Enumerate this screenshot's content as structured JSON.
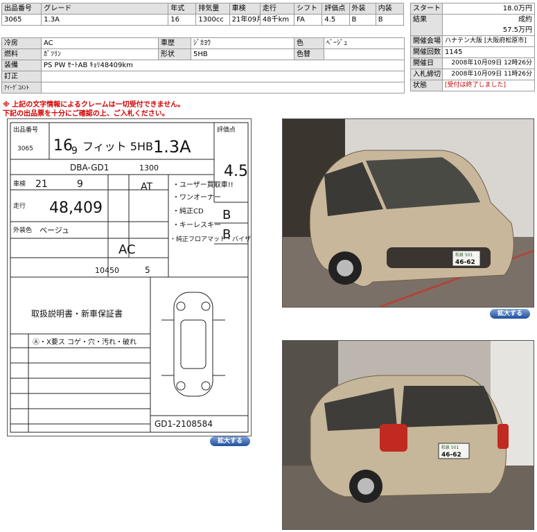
{
  "top_table": {
    "headers": [
      "出品番号",
      "グレード",
      "年式",
      "排気量",
      "車検",
      "走行",
      "シフト",
      "評価点",
      "外装",
      "内装"
    ],
    "values": [
      "3065",
      "1.3A",
      "16",
      "1300cc",
      "21年09月",
      "48千km",
      "FA",
      "4.5",
      "B",
      "B"
    ]
  },
  "spec_table": {
    "rows": [
      {
        "l1": "冷房",
        "v1": "AC",
        "l2": "車歴",
        "v2": "ｼﾞｶﾖｳ",
        "l3": "色",
        "v3": "ﾍﾞｰｼﾞｭ"
      },
      {
        "l1": "燃料",
        "v1": "ｶﾞｿﾘﾝ",
        "l2": "形状",
        "v2": "5HB",
        "l3": "色替",
        "v3": ""
      }
    ],
    "equipment_label": "装備",
    "equipment_value": "PS PW ｾｰﾄAB ｷｮﾘ48409km",
    "correction_label": "訂正",
    "correction_value": "",
    "eye_comment_label": "ｱｲｰｸﾞｺﾒﾝﾄ",
    "eye_comment_value": ""
  },
  "auction_table": {
    "start_label": "スタート",
    "start_value": "18.0万円",
    "result_label": "結果",
    "result_status": "成約",
    "result_price": "57.5万円",
    "venue_label": "開催会場",
    "venue_value": "ハナテン大阪 [大阪府松原市]",
    "count_label": "開催回数",
    "count_value": "1145",
    "date_label": "開催日",
    "date_value": "2008年10月09日 12時26分",
    "bid_end_label": "入札締切",
    "bid_end_value": "2008年10月09日 11時26分",
    "status_label": "状態",
    "status_value": "[受付は終了しました]"
  },
  "notice": {
    "line1": "※ 上記の文字情報によるクレームは一切受付できません。",
    "line2": "下記の出品票を十分にご確認の上、ご入札ください。"
  },
  "buttons": {
    "zoom_label": "拡大する"
  },
  "sheet": {
    "lot": "3065",
    "year": "16",
    "month": "9",
    "model": "フィット 5HB",
    "grade": "1.3A",
    "score": "4.5",
    "type_code": "DBA-GD1",
    "cc": "1300",
    "inspect_year": "21",
    "inspect_month": "9",
    "mileage": "48,409",
    "color": "ベージュ",
    "trans": "AT",
    "ac": "AC",
    "mileage_prev": "10450",
    "capacity": "5",
    "ext": "B",
    "int": "B",
    "chassis": "GD1-2108584",
    "notes": [
      "・ユーザー買取車!!",
      "・ワンオーナー",
      "・純正CD",
      "・キーレスキー",
      "・純正フロアマット・バイザー"
    ],
    "manual": "取扱説明書・新車保証書",
    "defect_line": "Ⓐ・X要ス  コゲ・穴・汚れ・破れ"
  },
  "photos": {
    "plate_small": "和泉 501",
    "plate_number": "46-62"
  }
}
